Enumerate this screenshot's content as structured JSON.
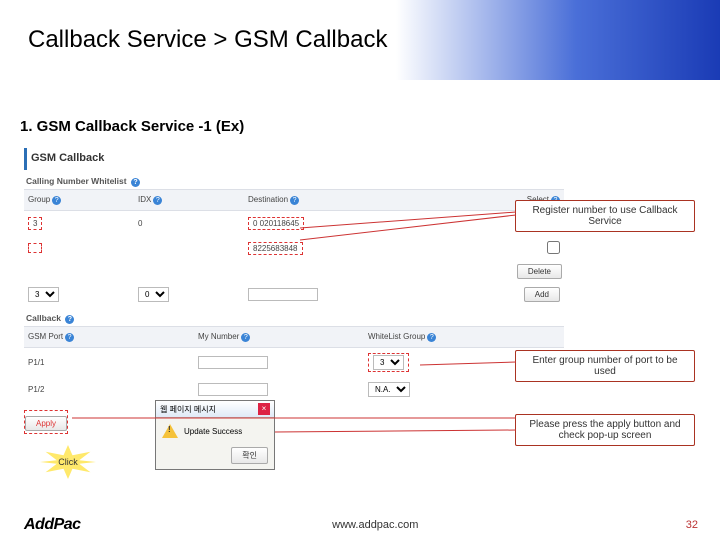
{
  "title": "Callback Service > GSM Callback",
  "subtitle": "1. GSM Callback Service -1 (Ex)",
  "panel": {
    "heading": "GSM Callback",
    "section1": {
      "label": "Calling Number Whitelist",
      "headers": {
        "group": "Group",
        "idx": "IDX",
        "dest": "Destination",
        "sel": "Select"
      },
      "row1": {
        "group": "3",
        "idx": "0",
        "dest": "0 020118645"
      },
      "row2": {
        "group_placeholder": "",
        "dest": "8225683848"
      },
      "btn_delete": "Delete",
      "newrow": {
        "group": "3",
        "idx": "0"
      },
      "btn_add": "Add"
    },
    "section2": {
      "label": "Callback",
      "headers": {
        "port": "GSM Port",
        "mynum": "My Number",
        "wlgroup": "WhiteList Group"
      },
      "row1": {
        "port": "P1/1",
        "wlgroup": "3"
      },
      "row2": {
        "port": "P1/2",
        "wlgroup": "N.A."
      }
    },
    "apply": "Apply"
  },
  "star": "Click",
  "popup": {
    "title": "웹 페이지 메시지",
    "msg": "Update Success",
    "ok": "확인"
  },
  "callouts": {
    "a": "Register number to use Callback Service",
    "b": "Enter group number of port to be used",
    "c": "Please press the apply button and check pop-up screen"
  },
  "footer": {
    "logo": "AddPac",
    "www": "www.addpac.com",
    "page": "32"
  }
}
